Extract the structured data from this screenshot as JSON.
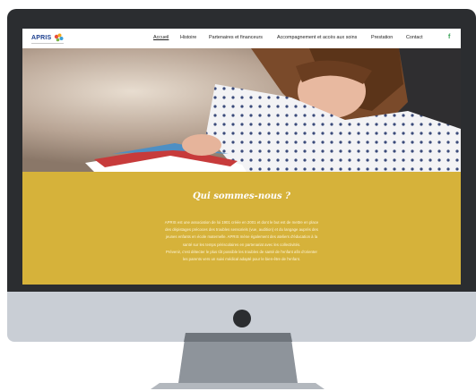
{
  "site": {
    "logo_text": "APRIS",
    "nav": [
      {
        "label": "Accueil",
        "active": true
      },
      {
        "label": "Histoire",
        "active": false
      },
      {
        "label": "Partenaires et financeurs",
        "active": false
      },
      {
        "label": "Accompagnement et accès aux soins",
        "active": false
      },
      {
        "label": "Prestation",
        "active": false
      },
      {
        "label": "Contact",
        "active": false
      }
    ],
    "social_icon": "f",
    "hero_image": "girl-reading-book-photo",
    "about": {
      "title": "Qui sommes-nous ?",
      "lines": [
        "APRIS est une association de loi 1901 créée en 2001 et dont le but est de mettre en place",
        "des dépistages précoces des troubles sensoriels (vue, audition) et du langage auprès des",
        "jeunes enfants en école maternelle. APRIS mène également des ateliers d'éducation à la",
        "santé sur les temps périscolaires en partenariat avec les collectivités.",
        "Prévenir, c'est détecter le plus tôt possible les troubles de santé de l'enfant afin d'orienter",
        "les parents vers un suivi médical adapté pour le bien-être de l'enfant."
      ]
    }
  },
  "colors": {
    "brand_blue": "#1c3f8f",
    "about_bg": "#d6b23a",
    "bezel": "#2b2d30",
    "chin": "#c9ced5",
    "stand": "#8e949b"
  }
}
